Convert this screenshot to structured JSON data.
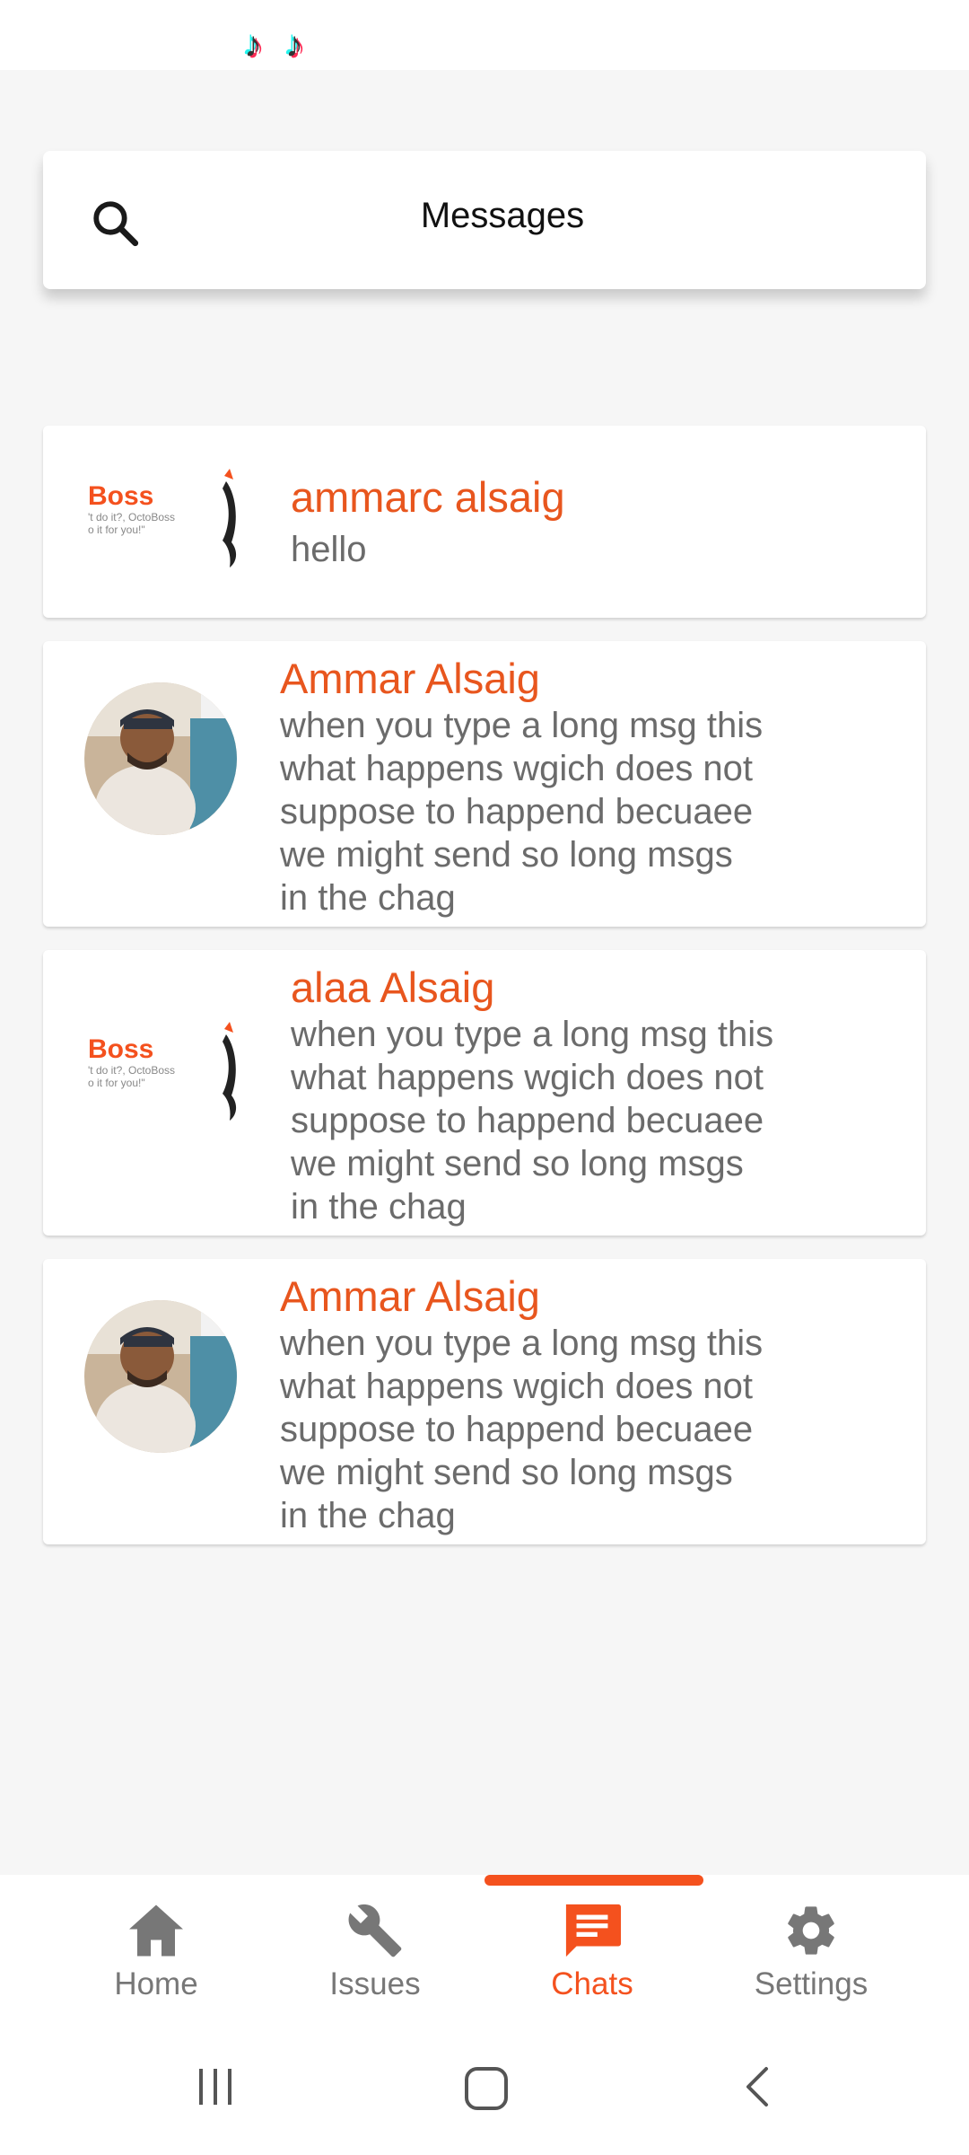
{
  "header": {
    "title": "Messages"
  },
  "conversations": [
    {
      "name": "ammarc alsaig",
      "message": "hello",
      "avatar": "octoboss-logo"
    },
    {
      "name": "Ammar Alsaig",
      "message": "when you type a long msg this\nwhat happens wgich does not\nsuppose to happend becuaee\nwe might send so long msgs\nin the chag",
      "avatar": "user-photo"
    },
    {
      "name": "alaa Alsaig",
      "message": "when you type a long msg this\nwhat happens wgich does not\nsuppose to happend becuaee\nwe might send so long msgs\nin the chag",
      "avatar": "octoboss-logo"
    },
    {
      "name": "Ammar Alsaig",
      "message": "when you type a long msg this\nwhat happens wgich does not\nsuppose to happend becuaee\nwe might send so long msgs\nin the chag",
      "avatar": "user-photo"
    }
  ],
  "logo": {
    "brand": "Boss",
    "tagline_1": "'t do it?, OctoBoss",
    "tagline_2": "o it for you!\""
  },
  "bottom_nav": {
    "items": [
      {
        "label": "Home",
        "icon": "home-icon"
      },
      {
        "label": "Issues",
        "icon": "wrench-icon"
      },
      {
        "label": "Chats",
        "icon": "chat-icon",
        "active": true
      },
      {
        "label": "Settings",
        "icon": "gear-icon"
      }
    ]
  },
  "colors": {
    "accent": "#f4511e",
    "name_text": "#e8561e",
    "message_text": "#6b6b6b",
    "background": "#f6f6f6"
  }
}
